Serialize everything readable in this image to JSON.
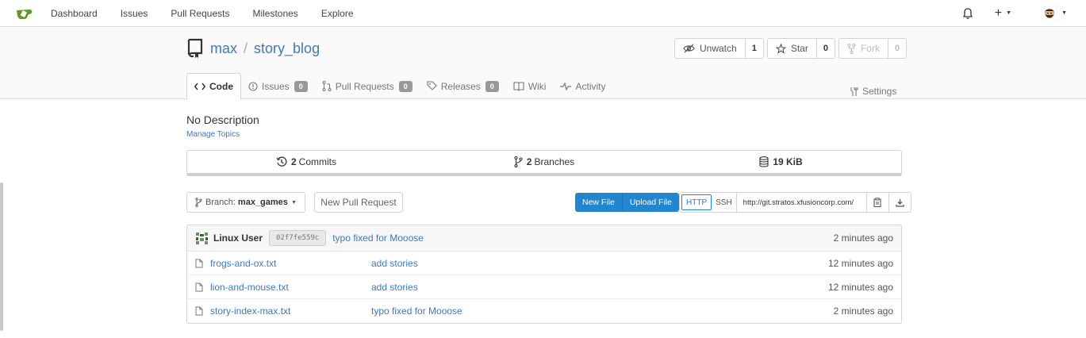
{
  "nav": {
    "items": [
      "Dashboard",
      "Issues",
      "Pull Requests",
      "Milestones",
      "Explore"
    ],
    "plus_label": "+"
  },
  "repo": {
    "owner": "max",
    "separator": "/",
    "name": "story_blog",
    "watch": {
      "label": "Unwatch",
      "count": "1"
    },
    "star": {
      "label": "Star",
      "count": "0"
    },
    "fork": {
      "label": "Fork",
      "count": "0"
    }
  },
  "tabs": {
    "code": "Code",
    "issues": {
      "label": "Issues",
      "count": "0"
    },
    "pulls": {
      "label": "Pull Requests",
      "count": "0"
    },
    "releases": {
      "label": "Releases",
      "count": "0"
    },
    "wiki": "Wiki",
    "activity": "Activity",
    "settings": "Settings"
  },
  "description": "No Description",
  "manage_topics": "Manage Topics",
  "stats": {
    "commits_num": "2",
    "commits_label": "Commits",
    "branches_num": "2",
    "branches_label": "Branches",
    "size": "19 KiB"
  },
  "toolbar": {
    "branch_prefix": "Branch:",
    "branch_name": "max_games",
    "new_pull_request": "New Pull Request",
    "new_file": "New File",
    "upload_file": "Upload File",
    "http": "HTTP",
    "ssh": "SSH",
    "clone_url": "http://git.stratos.xfusioncorp.com/"
  },
  "latest_commit": {
    "author": "Linux User",
    "sha": "02f7fe559c",
    "message": "typo fixed for Mooose",
    "age": "2 minutes ago"
  },
  "files": [
    {
      "name": "frogs-and-ox.txt",
      "message": "add stories",
      "age": "12 minutes ago"
    },
    {
      "name": "lion-and-mouse.txt",
      "message": "add stories",
      "age": "12 minutes ago"
    },
    {
      "name": "story-index-max.txt",
      "message": "typo fixed for Mooose",
      "age": "2 minutes ago"
    }
  ],
  "colors": {
    "accent": "#2185d0",
    "link": "#4078c0",
    "logo": "#609926"
  }
}
